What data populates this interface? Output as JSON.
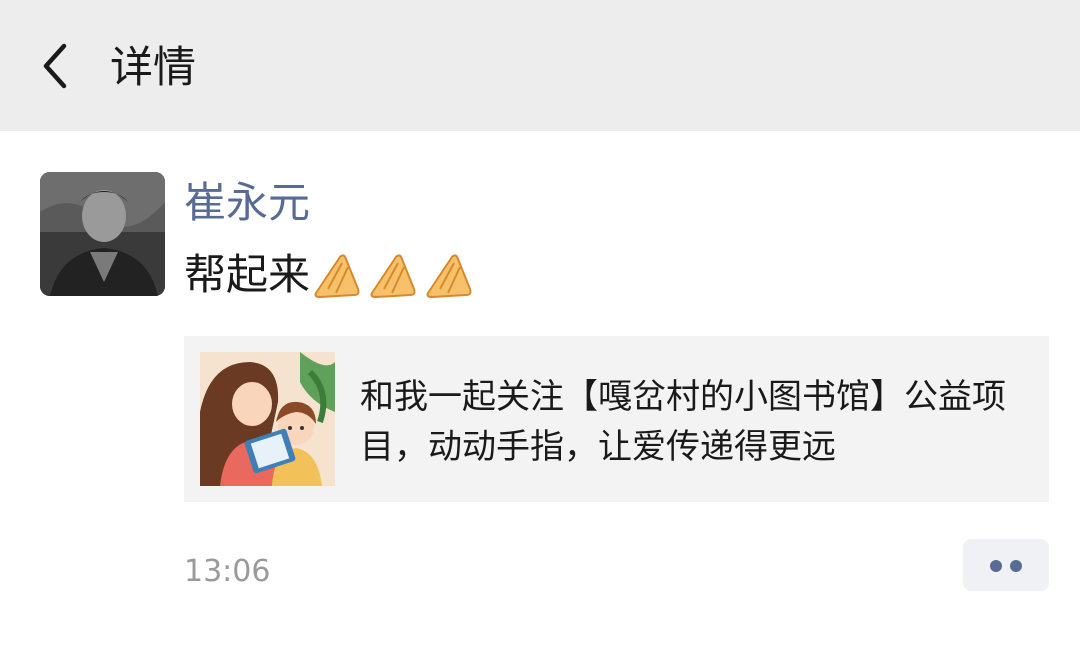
{
  "header": {
    "title": "详情",
    "back_icon": "chevron-left-icon"
  },
  "post": {
    "author": "崔永元",
    "text": "帮起来",
    "emoji": [
      "folded-hands",
      "folded-hands",
      "folded-hands"
    ],
    "share_card": {
      "text": "和我一起关注【嘎岔村的小图书馆】公益项目，动动手指，让爱传递得更远",
      "thumbnail": "mother-and-child-reading-illustration"
    },
    "time": "13:06",
    "more_icon": "more-dots-icon"
  },
  "colors": {
    "header_bg": "#ededed",
    "name_link": "#576b95",
    "card_bg": "#f3f3f3"
  }
}
